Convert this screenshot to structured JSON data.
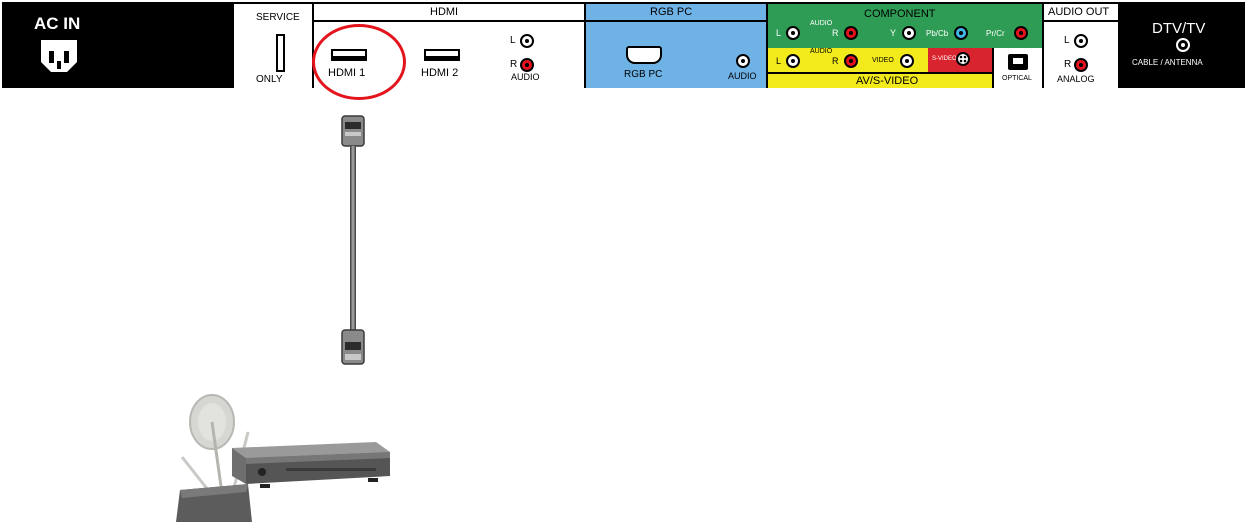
{
  "panel": {
    "ac_in": "AC IN",
    "service": {
      "title": "SERVICE",
      "sub": "ONLY"
    },
    "hdmi": {
      "title": "HDMI",
      "port1": "HDMI 1",
      "port2": "HDMI 2",
      "audio_l": "L",
      "audio_r": "R",
      "audio": "AUDIO"
    },
    "rgb": {
      "title": "RGB PC",
      "port": "RGB PC",
      "audio": "AUDIO"
    },
    "component": {
      "title": "COMPONENT",
      "audio": "AUDIO",
      "l": "L",
      "r": "R",
      "y": "Y",
      "pb": "Pb/Cb",
      "pr": "Pr/Cr"
    },
    "av": {
      "title": "AV/S-VIDEO",
      "audio": "AUDIO",
      "l": "L",
      "r": "R",
      "video": "VIDEO",
      "svideo": "S-VIDEO"
    },
    "optical": "OPTICAL",
    "audio_out": {
      "title": "AUDIO OUT",
      "l": "L",
      "r": "R",
      "analog": "ANALOG"
    },
    "dtv": {
      "title": "DTV/TV",
      "sub": "CABLE / ANTENNA"
    }
  },
  "colors": {
    "panel_black": "#000000",
    "rgb_blue": "#6fb2e6",
    "component_green": "#2f9c55",
    "av_yellow": "#f3ea1c",
    "svideo_red": "#d8242f",
    "highlight_red": "#e4141c"
  }
}
